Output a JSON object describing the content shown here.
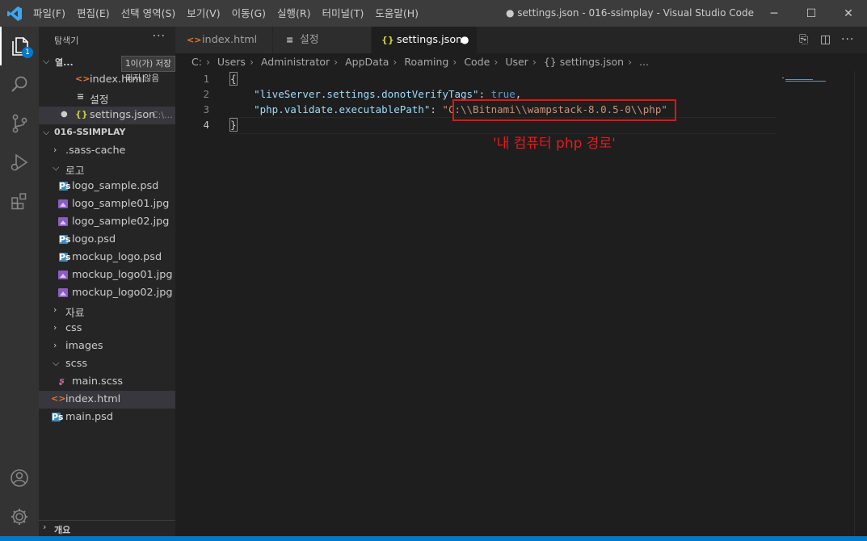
{
  "titlebar": {
    "menu": [
      "파일(F)",
      "편집(E)",
      "선택 영역(S)",
      "보기(V)",
      "이동(G)",
      "실행(R)",
      "터미널(T)",
      "도움말(H)"
    ],
    "window_title": "● settings.json - 016-ssimplay - Visual Studio Code",
    "minimize": "─",
    "maximize": "☐",
    "close": "✕"
  },
  "activity": {
    "badge": "1"
  },
  "sidebar": {
    "header": "탐색기",
    "more": "···",
    "open_editors_label": "열...",
    "tooltip": "1이(가) 저장되지 않음",
    "open_editors": [
      {
        "icon": "<>",
        "label": "index.html"
      },
      {
        "icon": "≡",
        "label": "설정"
      },
      {
        "icon": "{}",
        "label": "settings.json",
        "path": "C:\\...",
        "dirty": "●"
      }
    ],
    "project_label": "016-SSIMPLAY",
    "tree": [
      {
        "label": ".sass-cache"
      },
      {
        "label": "로고"
      },
      {
        "label": "logo_sample.psd"
      },
      {
        "label": "logo_sample01.jpg"
      },
      {
        "label": "logo_sample02.jpg"
      },
      {
        "label": "logo.psd"
      },
      {
        "label": "mockup_logo.psd"
      },
      {
        "label": "mockup_logo01.jpg"
      },
      {
        "label": "mockup_logo02.jpg"
      },
      {
        "label": "자료"
      },
      {
        "label": "css"
      },
      {
        "label": "images"
      },
      {
        "label": "scss"
      },
      {
        "label": "main.scss"
      },
      {
        "label": "index.html"
      },
      {
        "label": "main.psd"
      }
    ],
    "outline_label": "개요"
  },
  "tabs": [
    {
      "icon": "<>",
      "label": "index.html"
    },
    {
      "icon": "≡",
      "label": "설정"
    },
    {
      "icon": "{}",
      "label": "settings.json",
      "dirty": "●"
    }
  ],
  "breadcrumb": [
    "C:",
    "Users",
    "Administrator",
    "AppData",
    "Roaming",
    "Code",
    "User",
    "{} settings.json",
    "..."
  ],
  "editor": {
    "line_numbers": [
      "1",
      "2",
      "3",
      "4"
    ],
    "line1": "{",
    "line2_key": "\"liveServer.settings.donotVerifyTags\"",
    "line2_colon": ": ",
    "line2_val": "true",
    "line2_end": ",",
    "line3_key": "\"php.validate.executablePath\"",
    "line3_colon": ": ",
    "line3_val": "\"C:\\\\Bitnami\\\\wampstack-8.0.5-0\\\\php\"",
    "line4": "}",
    "annotation": "'내 컴퓨터 php 경로'"
  }
}
